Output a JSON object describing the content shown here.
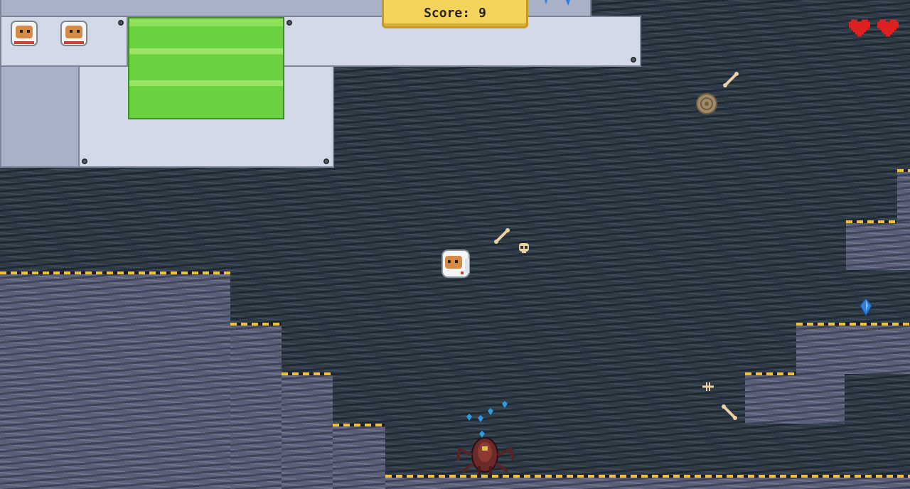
{
  "hud": {
    "score_label": "Score:",
    "score_value": "9",
    "lives_remaining": 2,
    "hearts": 2
  },
  "colors": {
    "cave_wall": "#2f3c47",
    "rock": "#5a6079",
    "panel": "#d3d9e6",
    "acid": "#6bd23f",
    "hazard_stripe": "#f2c230",
    "heart": "#e02020",
    "score_box": "#f3d35b"
  },
  "entities": {
    "player": "astronaut",
    "enemy": "red-cave-crawler",
    "pickups": [
      "blue-crystal",
      "bone",
      "skull",
      "fossil-shell"
    ]
  }
}
